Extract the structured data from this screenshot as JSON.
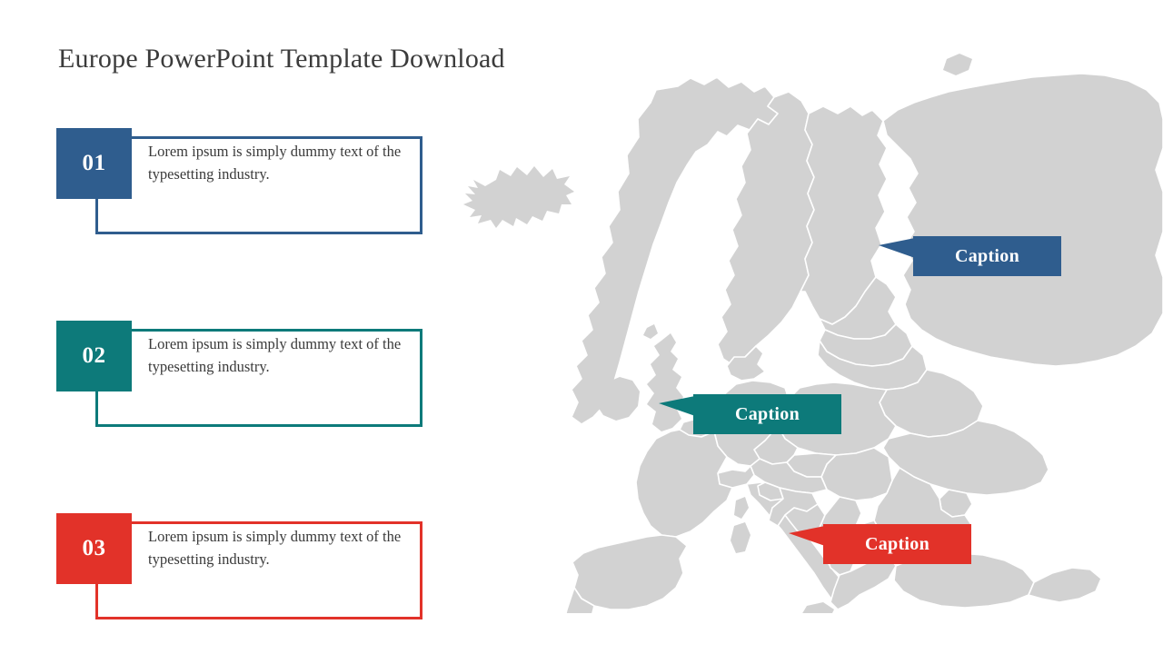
{
  "slide": {
    "title": "Europe PowerPoint Template Download",
    "background_color": "#ffffff"
  },
  "colors": {
    "blue": "#2f5d8e",
    "teal": "#0d7a7a",
    "red": "#e23229",
    "map_land": "#d2d2d2",
    "map_border": "#ffffff",
    "title_text": "#3b3b3b",
    "body_text": "#3a3a3a"
  },
  "items": [
    {
      "number": "01",
      "text": "Lorem ipsum is simply dummy text of the typesetting industry.",
      "color": "#2f5d8e",
      "color_name": "blue"
    },
    {
      "number": "02",
      "text": "Lorem ipsum is simply dummy text of the typesetting industry.",
      "color": "#0d7a7a",
      "color_name": "teal"
    },
    {
      "number": "03",
      "text": "Lorem ipsum is simply dummy text of the typesetting industry.",
      "color": "#e23229",
      "color_name": "red"
    }
  ],
  "map": {
    "region": "Europe",
    "land_color": "#d2d2d2",
    "border_color": "#ffffff",
    "callouts": [
      {
        "label": "Caption",
        "color": "#2f5d8e",
        "color_name": "blue"
      },
      {
        "label": "Caption",
        "color": "#0d7a7a",
        "color_name": "teal"
      },
      {
        "label": "Caption",
        "color": "#e23229",
        "color_name": "red"
      }
    ]
  }
}
